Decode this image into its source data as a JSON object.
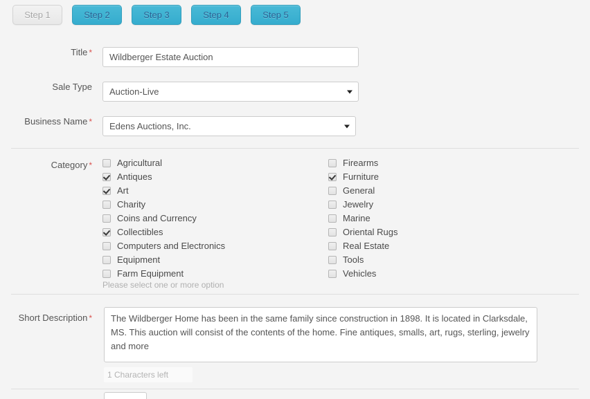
{
  "steps": [
    {
      "label": "Step 1",
      "active": false
    },
    {
      "label": "Step 2",
      "active": true
    },
    {
      "label": "Step 3",
      "active": true
    },
    {
      "label": "Step 4",
      "active": true
    },
    {
      "label": "Step 5",
      "active": true
    }
  ],
  "fields": {
    "title": {
      "label": "Title",
      "required": true,
      "value": "Wildberger Estate Auction",
      "placeholder": ""
    },
    "sale_type": {
      "label": "Sale Type",
      "required": false,
      "value": "Auction-Live"
    },
    "business_name": {
      "label": "Business Name",
      "required": true,
      "value": "Edens Auctions, Inc."
    },
    "category": {
      "label": "Category",
      "required": true,
      "help": "Please select one or more option"
    },
    "short_description": {
      "label": "Short Description",
      "required": true,
      "value": "The Wildberger Home has been in the same family since construction in 1898. It is located in Clarksdale, MS. This auction will consist of the contents of the home. Fine antiques, smalls, art, rugs, sterling, jewelry and more",
      "counter": "1 Characters left"
    }
  },
  "categories": {
    "left": [
      {
        "label": "Agricultural",
        "checked": false
      },
      {
        "label": "Antiques",
        "checked": true
      },
      {
        "label": "Art",
        "checked": true
      },
      {
        "label": "Charity",
        "checked": false
      },
      {
        "label": "Coins and Currency",
        "checked": false
      },
      {
        "label": "Collectibles",
        "checked": true
      },
      {
        "label": "Computers and Electronics",
        "checked": false
      },
      {
        "label": "Equipment",
        "checked": false
      },
      {
        "label": "Farm Equipment",
        "checked": false
      }
    ],
    "right": [
      {
        "label": "Firearms",
        "checked": false
      },
      {
        "label": "Furniture",
        "checked": true
      },
      {
        "label": "General",
        "checked": false
      },
      {
        "label": "Jewelry",
        "checked": false
      },
      {
        "label": "Marine",
        "checked": false
      },
      {
        "label": "Oriental Rugs",
        "checked": false
      },
      {
        "label": "Real Estate",
        "checked": false
      },
      {
        "label": "Tools",
        "checked": false
      },
      {
        "label": "Vehicles",
        "checked": false
      }
    ]
  },
  "colors": {
    "page_bg": "#f4f4f4",
    "step_active": "#3fb3d2",
    "step_active_text": "#2a6496",
    "step_inactive_text": "#a8a8a8",
    "required_asterisk": "#d9534f",
    "divider": "#dedede",
    "input_border": "#cccccc",
    "muted_text": "#b0b0b0"
  }
}
